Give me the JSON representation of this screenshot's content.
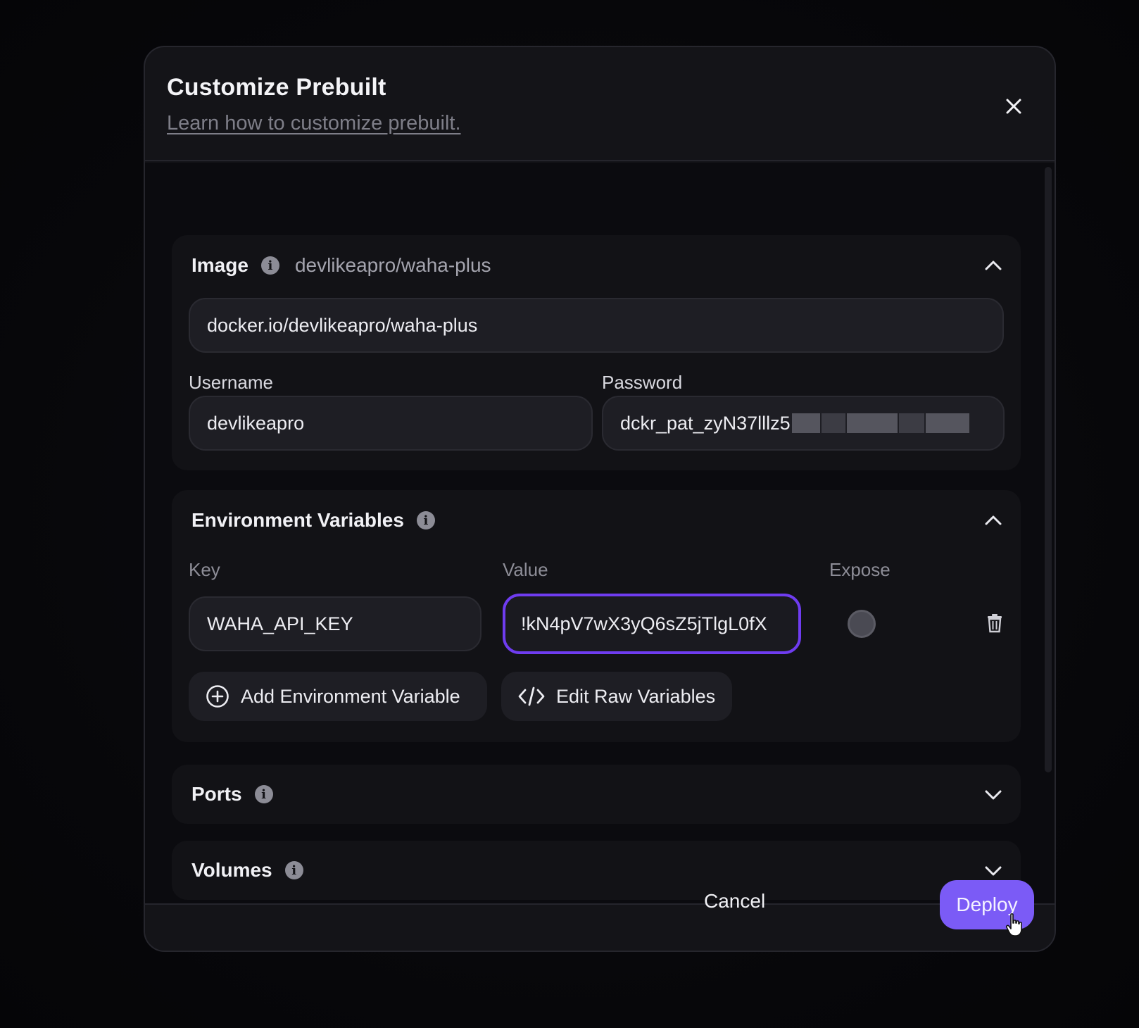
{
  "modal": {
    "title": "Customize Prebuilt",
    "help_link": "Learn how to customize prebuilt."
  },
  "image_section": {
    "title": "Image",
    "subtitle": "devlikeapro/waha-plus",
    "image_value": "docker.io/devlikeapro/waha-plus",
    "username_label": "Username",
    "username_value": "devlikeapro",
    "password_label": "Password",
    "password_value": "dckr_pat_zyN37lllz5",
    "expanded": true
  },
  "env_section": {
    "title": "Environment Variables",
    "key_header": "Key",
    "value_header": "Value",
    "expose_header": "Expose",
    "rows": [
      {
        "key": "WAHA_API_KEY",
        "value": "!kN4pV7wX3yQ6sZ5jTlgL0fX",
        "expose": false
      }
    ],
    "add_button": "Add Environment Variable",
    "raw_button": "Edit Raw Variables",
    "expanded": true
  },
  "ports_section": {
    "title": "Ports",
    "expanded": false
  },
  "volumes_section": {
    "title": "Volumes",
    "expanded": false
  },
  "footer": {
    "cancel_label": "Cancel",
    "deploy_label": "Deploy"
  },
  "colors": {
    "accent": "#7b5bf6",
    "focus_ring": "#6f3cf0",
    "modal_bg": "#141418",
    "body_bg": "#0b0b0f"
  },
  "icons": {
    "close": "close-icon",
    "info": "info-icon",
    "chevron_up": "chevron-up-icon",
    "chevron_down": "chevron-down-icon",
    "trash": "trash-icon",
    "add": "plus-circle-icon",
    "code": "code-icon",
    "cursor": "hand-pointer-icon"
  }
}
